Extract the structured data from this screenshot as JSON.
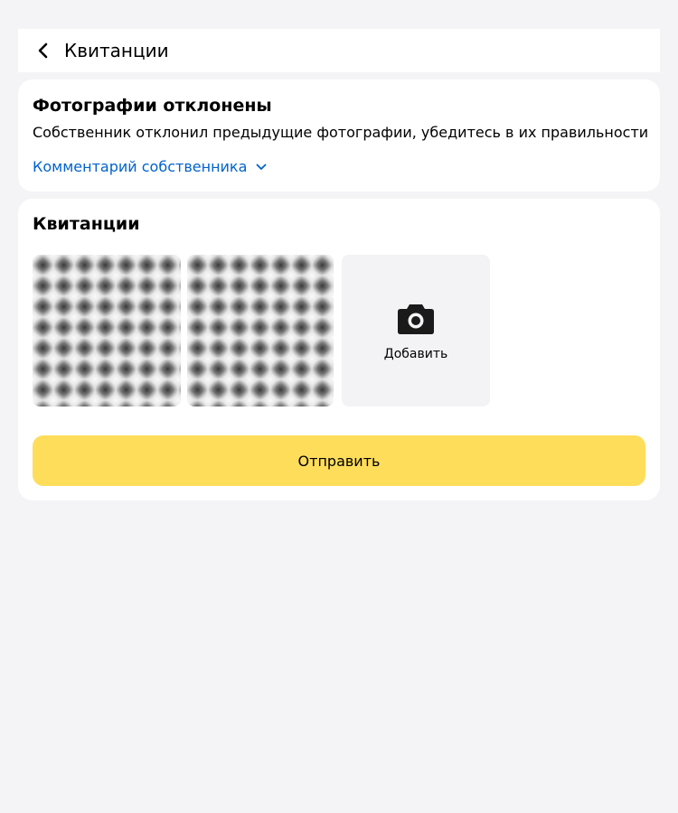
{
  "header": {
    "title": "Квитанции",
    "back_icon": "chevron-left-icon"
  },
  "warning": {
    "title": "Фотографии отклонены",
    "text": "Собственник отклонил предыдущие фотографии, убедитесь в их правильности",
    "owner_comment_label": "Комментарий собственника",
    "owner_comment_icon": "chevron-down-icon",
    "link_color": "#0062cc"
  },
  "receipts": {
    "title": "Квитанции",
    "photos_count_shown": 2,
    "add_label": "Добавить",
    "add_icon": "camera-icon"
  },
  "actions": {
    "send_label": "Отправить",
    "send_color": "#fedd5b"
  }
}
